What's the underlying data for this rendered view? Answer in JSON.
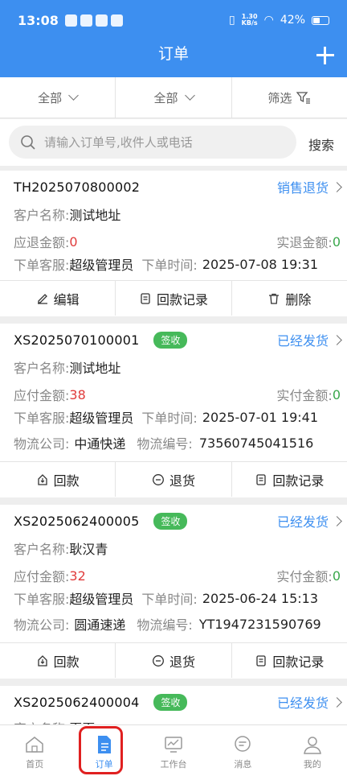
{
  "status_bar": {
    "time": "13:08",
    "speed_top": "1.30",
    "speed_bottom": "KB/s",
    "battery": "42%"
  },
  "header": {
    "title": "订单"
  },
  "filters": [
    {
      "label": "全部"
    },
    {
      "label": "全部"
    },
    {
      "label": "筛选"
    }
  ],
  "search": {
    "placeholder": "请输入订单号,收件人或电话",
    "button": "搜索"
  },
  "labels": {
    "customer": "客户名称:",
    "should_refund": "应退金额:",
    "actual_refund": "实退金额:",
    "should_pay": "应付金额:",
    "actual_pay": "实付金额:",
    "staff": "下单客服:",
    "time": "下单时间:",
    "logistics": "物流公司:",
    "tracking": "物流编号:"
  },
  "orders": [
    {
      "no": "TH2025070800002",
      "badge": "",
      "status": "销售退货",
      "customer": "测试地址",
      "amount_due": "0",
      "amount_paid": "0",
      "staff": "超级管理员",
      "time": "2025-07-08 19:31",
      "actions": [
        "编辑",
        "回款记录",
        "删除"
      ]
    },
    {
      "no": "XS2025070100001",
      "badge": "签收",
      "status": "已经发货",
      "customer": "测试地址",
      "amount_due": "38",
      "amount_paid": "0",
      "staff": "超级管理员",
      "time": "2025-07-01 19:41",
      "logistics": "中通快递",
      "tracking": "73560745041516",
      "actions": [
        "回款",
        "退货",
        "回款记录"
      ]
    },
    {
      "no": "XS2025062400005",
      "badge": "签收",
      "status": "已经发货",
      "customer": "耿汉青",
      "amount_due": "32",
      "amount_paid": "0",
      "staff": "超级管理员",
      "time": "2025-06-24 15:13",
      "logistics": "圆通速递",
      "tracking": "YT1947231590769",
      "actions": [
        "回款",
        "退货",
        "回款记录"
      ]
    },
    {
      "no": "XS2025062400004",
      "badge": "签收",
      "status": "已经发货",
      "customer": "夏夏"
    }
  ],
  "tabs": [
    {
      "label": "首页",
      "icon": "home-icon"
    },
    {
      "label": "订单",
      "icon": "order-icon"
    },
    {
      "label": "工作台",
      "icon": "workbench-icon"
    },
    {
      "label": "消息",
      "icon": "message-icon"
    },
    {
      "label": "我的",
      "icon": "profile-icon"
    }
  ],
  "colors": {
    "primary": "#3d8ff0",
    "badge": "#46b95a",
    "due": "#e03b3b",
    "paid": "#3aa84c"
  }
}
